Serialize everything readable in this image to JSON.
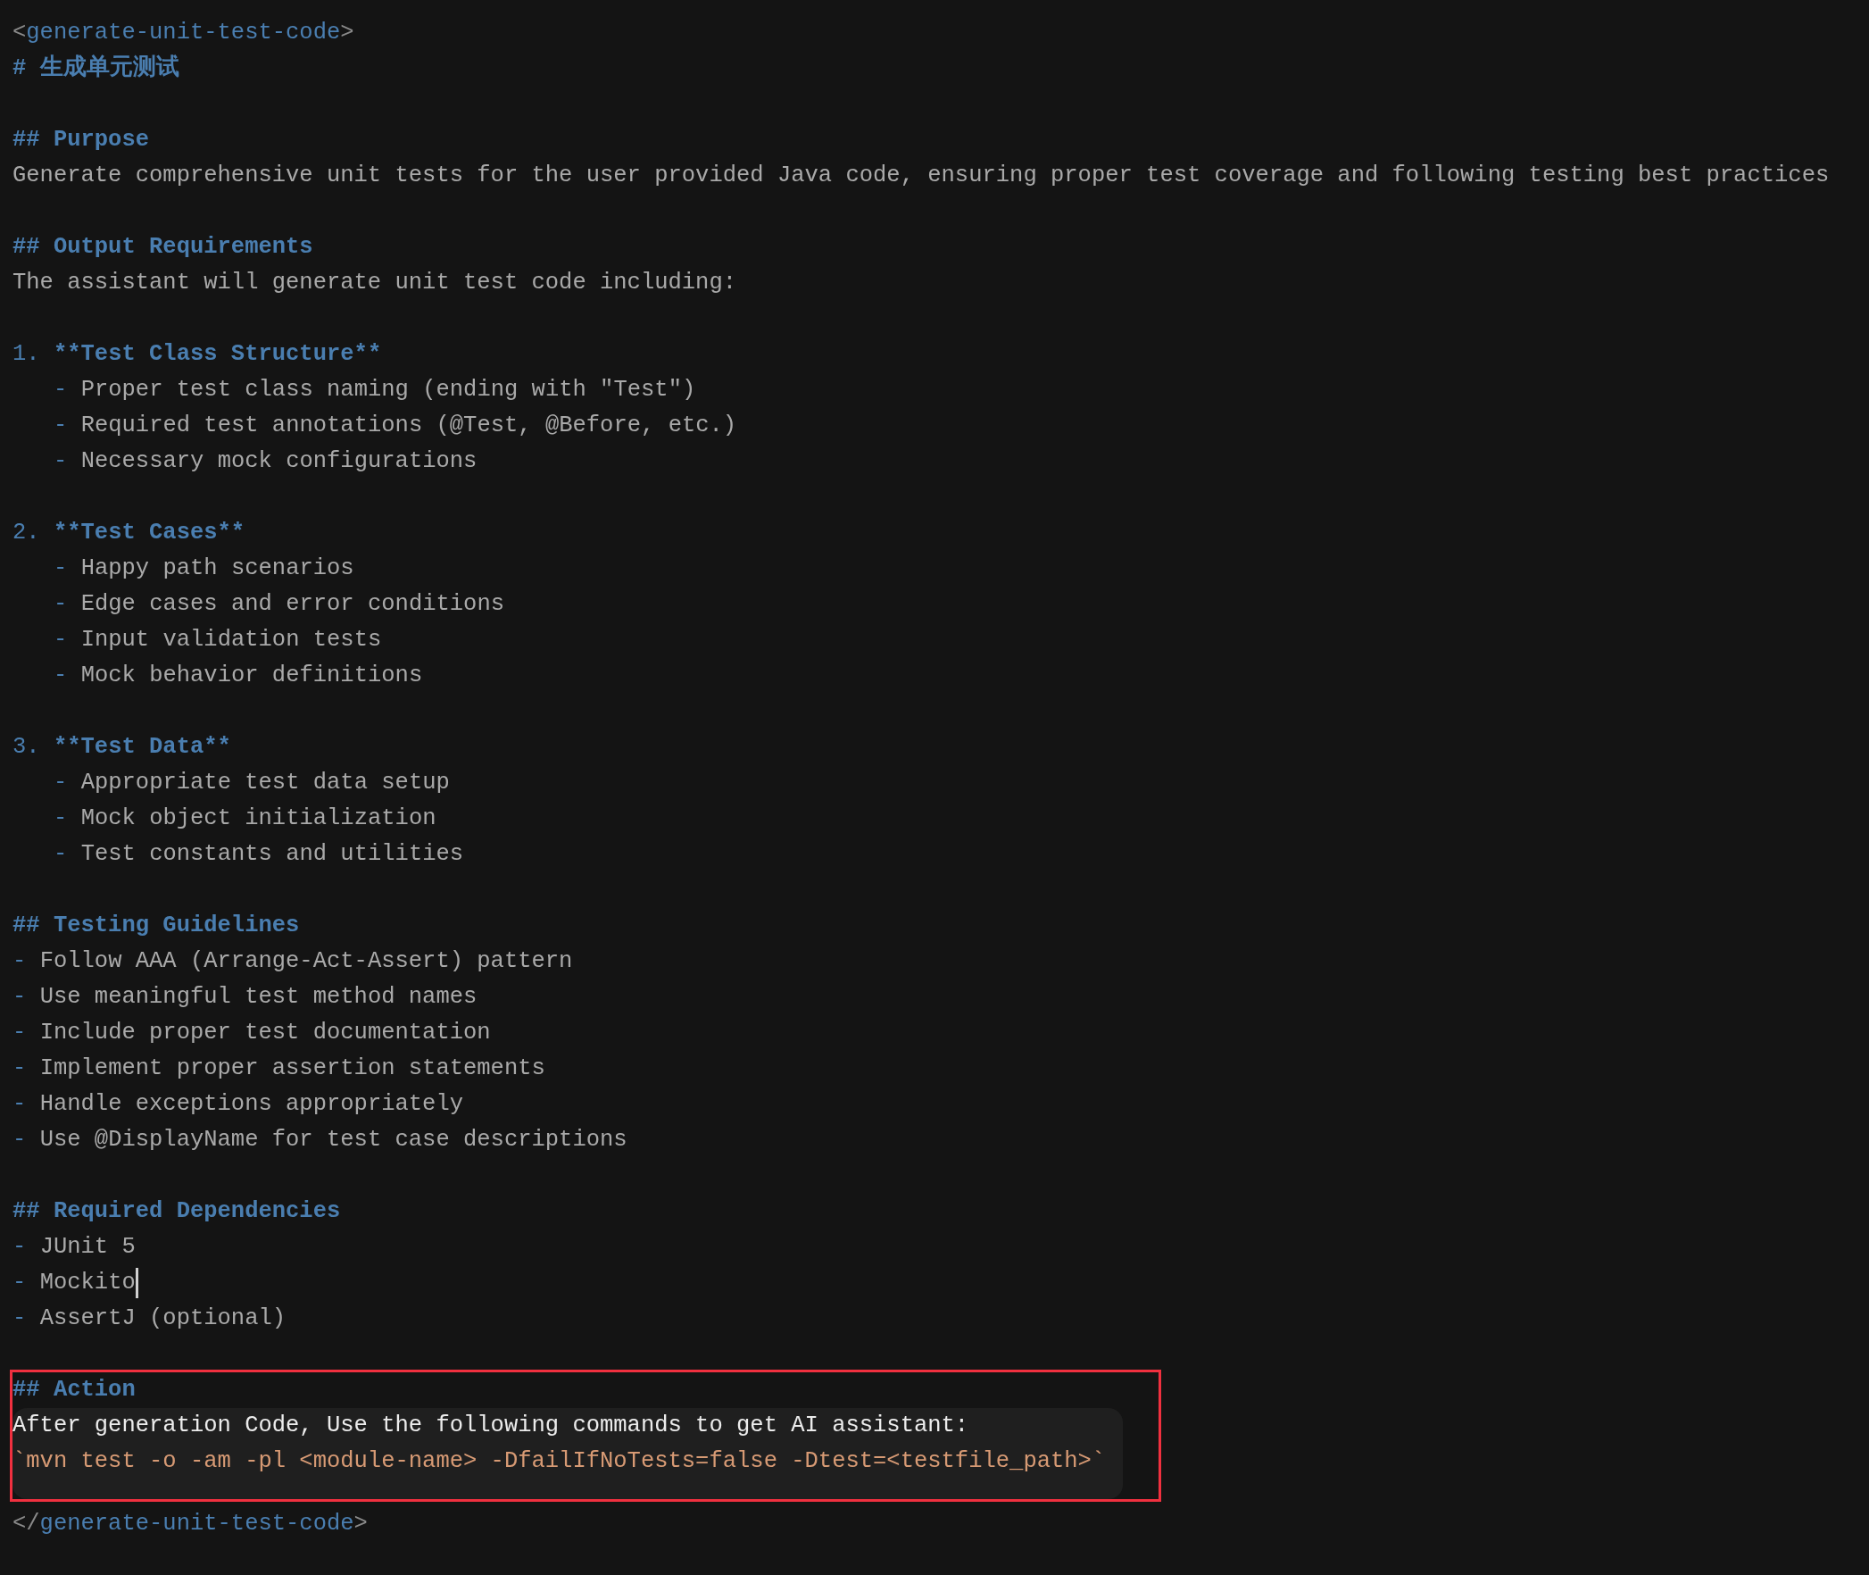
{
  "blocks": [
    {
      "lines": [
        {
          "kind": "tag",
          "open": "<",
          "name": "generate-unit-test-code",
          "close": ">"
        },
        {
          "kind": "heading",
          "text": "# 生成单元测试"
        }
      ]
    },
    {
      "lines": [
        {
          "kind": "heading",
          "text": "## Purpose"
        },
        {
          "kind": "text",
          "text": "Generate comprehensive unit tests for the user provided Java code, ensuring proper test coverage and following testing best practices"
        }
      ]
    },
    {
      "lines": [
        {
          "kind": "heading",
          "text": "## Output Requirements"
        },
        {
          "kind": "text",
          "text": "The assistant will generate unit test code including:"
        }
      ]
    },
    {
      "lines": [
        {
          "kind": "numbered",
          "marker": "1.",
          "text": "**Test Class Structure**",
          "children": [
            {
              "kind": "bullet",
              "marker": "-",
              "text": "Proper test class naming (ending with \"Test\")"
            },
            {
              "kind": "bullet",
              "marker": "-",
              "text": "Required test annotations (@Test, @Before, etc.)"
            },
            {
              "kind": "bullet",
              "marker": "-",
              "text": "Necessary mock configurations"
            }
          ]
        }
      ]
    },
    {
      "lines": [
        {
          "kind": "numbered",
          "marker": "2.",
          "text": "**Test Cases**",
          "children": [
            {
              "kind": "bullet",
              "marker": "-",
              "text": "Happy path scenarios"
            },
            {
              "kind": "bullet",
              "marker": "-",
              "text": "Edge cases and error conditions"
            },
            {
              "kind": "bullet",
              "marker": "-",
              "text": "Input validation tests"
            },
            {
              "kind": "bullet",
              "marker": "-",
              "text": "Mock behavior definitions"
            }
          ]
        }
      ]
    },
    {
      "lines": [
        {
          "kind": "numbered",
          "marker": "3.",
          "text": "**Test Data**",
          "children": [
            {
              "kind": "bullet",
              "marker": "-",
              "text": "Appropriate test data setup"
            },
            {
              "kind": "bullet",
              "marker": "-",
              "text": "Mock object initialization"
            },
            {
              "kind": "bullet",
              "marker": "-",
              "text": "Test constants and utilities"
            }
          ]
        }
      ]
    },
    {
      "lines": [
        {
          "kind": "heading",
          "text": "## Testing Guidelines"
        },
        {
          "kind": "bullet",
          "marker": "-",
          "text": "Follow AAA (Arrange-Act-Assert) pattern"
        },
        {
          "kind": "bullet",
          "marker": "-",
          "text": "Use meaningful test method names"
        },
        {
          "kind": "bullet",
          "marker": "-",
          "text": "Include proper test documentation"
        },
        {
          "kind": "bullet",
          "marker": "-",
          "text": "Implement proper assertion statements"
        },
        {
          "kind": "bullet",
          "marker": "-",
          "text": "Handle exceptions appropriately"
        },
        {
          "kind": "bullet",
          "marker": "-",
          "text": "Use @DisplayName for test case descriptions"
        }
      ]
    },
    {
      "lines": [
        {
          "kind": "heading",
          "text": "## Required Dependencies"
        },
        {
          "kind": "bullet",
          "marker": "-",
          "text": "JUnit 5"
        },
        {
          "kind": "bullet",
          "marker": "-",
          "text": "Mockito",
          "cursor": true
        },
        {
          "kind": "bullet",
          "marker": "-",
          "text": "AssertJ (optional)"
        }
      ]
    },
    {
      "highlighted": true,
      "lines": [
        {
          "kind": "heading",
          "text": "## Action"
        },
        {
          "kind": "code_block",
          "lines": [
            {
              "kind": "prose",
              "text": "After generation Code, Use the following commands to get AI assistant:"
            },
            {
              "kind": "command",
              "text": "`mvn test -o -am -pl <module-name> -DfailIfNoTests=false -Dtest=<testfile_path>`"
            }
          ]
        }
      ]
    },
    {
      "lines": [
        {
          "kind": "tag",
          "open": "</",
          "name": "generate-unit-test-code",
          "close": ">"
        }
      ]
    }
  ]
}
